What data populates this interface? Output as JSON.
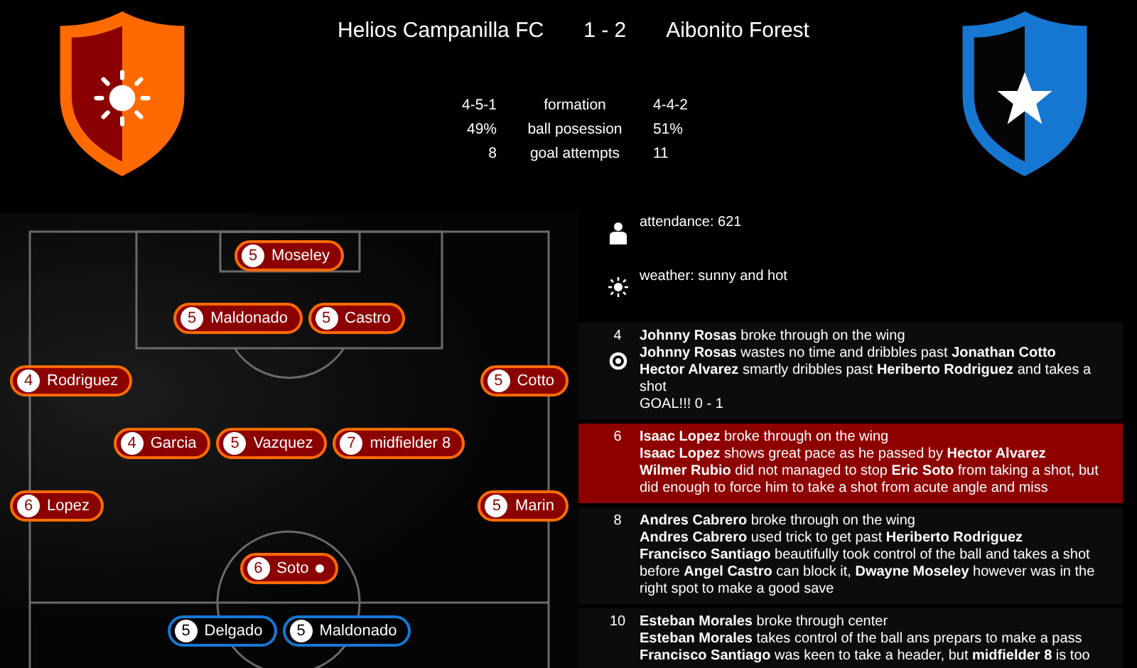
{
  "match": {
    "home": "Helios Campanilla FC",
    "score": "1 - 2",
    "away": "Aibonito Forest"
  },
  "crests": [
    {
      "kind": "home"
    },
    {
      "kind": "away"
    }
  ],
  "stats": [
    {
      "home": "4-5-1",
      "label": "formation",
      "away": "4-4-2"
    },
    {
      "home": "49%",
      "label": "ball posession",
      "away": "51%"
    },
    {
      "home": "8",
      "label": "goal attempts",
      "away": "11"
    }
  ],
  "pitch": {
    "rows": [
      {
        "kind": "center",
        "players": [
          {
            "kind": "home",
            "number": "5",
            "name": "Moseley",
            "has_ball": false
          }
        ]
      },
      {
        "kind": "center",
        "players": [
          {
            "kind": "home",
            "number": "5",
            "name": "Maldonado",
            "has_ball": false
          },
          {
            "kind": "home",
            "number": "5",
            "name": "Castro",
            "has_ball": false
          }
        ]
      },
      {
        "kind": "wide",
        "players": [
          {
            "kind": "home",
            "number": "4",
            "name": "Rodriguez",
            "has_ball": false
          },
          {
            "kind": "home",
            "number": "5",
            "name": "Cotto",
            "has_ball": false
          }
        ]
      },
      {
        "kind": "center",
        "players": [
          {
            "kind": "home",
            "number": "4",
            "name": "Garcia",
            "has_ball": false
          },
          {
            "kind": "home",
            "number": "5",
            "name": "Vazquez",
            "has_ball": false
          },
          {
            "kind": "home",
            "number": "7",
            "name": "midfielder 8",
            "has_ball": false
          }
        ]
      },
      {
        "kind": "wide",
        "players": [
          {
            "kind": "home",
            "number": "6",
            "name": "Lopez",
            "has_ball": false
          },
          {
            "kind": "home",
            "number": "5",
            "name": "Marin",
            "has_ball": false
          }
        ]
      },
      {
        "kind": "center",
        "players": [
          {
            "kind": "home",
            "number": "6",
            "name": "Soto",
            "has_ball": true
          }
        ]
      },
      {
        "kind": "center",
        "players": [
          {
            "kind": "away",
            "number": "5",
            "name": "Delgado",
            "has_ball": false
          },
          {
            "kind": "away",
            "number": "5",
            "name": "Maldonado",
            "has_ball": false
          }
        ]
      }
    ]
  },
  "info": [
    {
      "kind": "attendance",
      "text": "attendance: 621"
    },
    {
      "kind": "weather",
      "text": "weather: sunny and hot"
    }
  ],
  "events": [
    {
      "minute": "4",
      "kind": "goal",
      "highlighted": false,
      "lines": [
        "**Johnny Rosas** broke through on the wing",
        "**Johnny Rosas** wastes no time and dribbles past **Jonathan Cotto**",
        "**Hector Alvarez** smartly dribbles past **Heriberto Rodriguez** and takes a shot",
        "GOAL!!! 0 - 1"
      ]
    },
    {
      "minute": "6",
      "highlighted": true,
      "lines": [
        "**Isaac Lopez** broke through on the wing",
        "**Isaac Lopez** shows great pace as he passed by **Hector Alvarez**",
        "**Wilmer Rubio** did not managed to stop **Eric Soto** from taking a shot, but did enough to force him to take a shot from acute angle and miss"
      ]
    },
    {
      "minute": "8",
      "highlighted": false,
      "lines": [
        "**Andres Cabrero** broke through on the wing",
        "**Andres Cabrero** used trick to get past **Heriberto Rodriguez**",
        "**Francisco Santiago** beautifully took control of the ball and takes a shot before **Angel Castro** can block it, **Dwayne Moseley** however was in the right spot to make a good save"
      ]
    },
    {
      "minute": "10",
      "highlighted": false,
      "lines": [
        "**Esteban Morales** broke through center",
        "**Esteban Morales** takes control of the ball ans prepars to make a pass",
        "**Francisco Santiago** was keen to take a header, but **midfielder 8** is too"
      ]
    }
  ]
}
